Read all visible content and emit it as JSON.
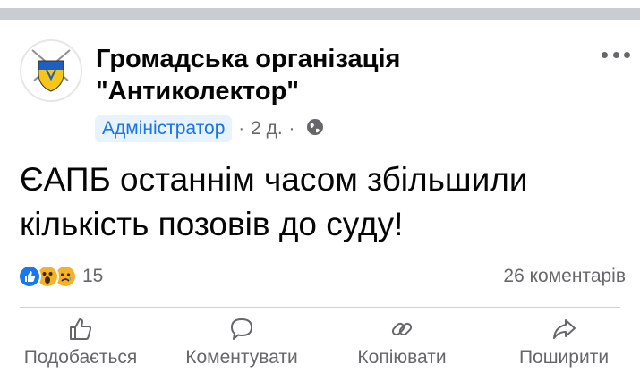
{
  "post": {
    "page_name_line1": "Громадська організація",
    "page_name_line2": "\"Антиколектор\"",
    "role_badge": "Адміністратор",
    "separator": "·",
    "time": "2 д.",
    "audience_icon": "globe-icon",
    "avatar_icon": "shield-crest-icon",
    "more_icon": "more-options-icon",
    "text_line1": "ЄАПБ останнім часом збільшили",
    "text_line2": "кількість позовів до суду!"
  },
  "engagement": {
    "reaction_icons": [
      "like-reaction-icon",
      "wow-reaction-icon",
      "sad-reaction-icon"
    ],
    "reaction_count": "15",
    "comments_count": "26 коментарів"
  },
  "actions": [
    {
      "label": "Подобається",
      "icon": "thumbs-up-icon"
    },
    {
      "label": "Коментувати",
      "icon": "comment-icon"
    },
    {
      "label": "Копіювати",
      "icon": "link-icon"
    },
    {
      "label": "Поширити",
      "icon": "share-icon"
    }
  ],
  "colors": {
    "badge_bg": "#e7f3ff",
    "badge_text": "#1b74e4",
    "secondary_text": "#65676b",
    "like_blue": "#1877f2"
  }
}
